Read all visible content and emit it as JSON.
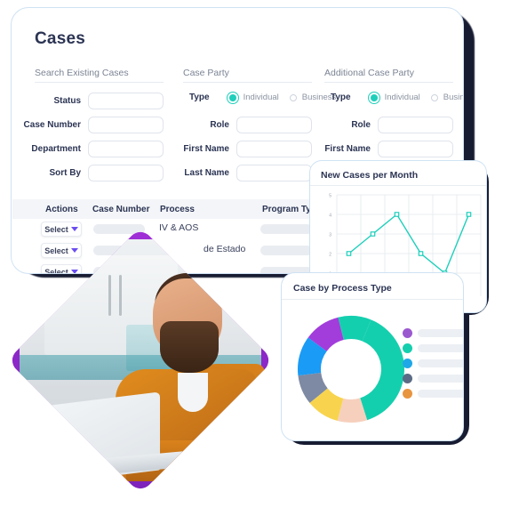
{
  "main_card": {
    "title": "Cases",
    "sections": [
      {
        "heading": "Search Existing Cases"
      },
      {
        "heading": "Case Party"
      },
      {
        "heading": "Additional Case Party"
      }
    ],
    "search_fields": [
      {
        "label": "Status",
        "value": "",
        "placeholder": ""
      },
      {
        "label": "Case Number",
        "value": "",
        "placeholder": ""
      },
      {
        "label": "Department",
        "value": "",
        "placeholder": ""
      },
      {
        "label": "Sort By",
        "value": "",
        "placeholder": ""
      }
    ],
    "case_party": {
      "type_label": "Type",
      "options": [
        {
          "label": "Individual",
          "selected": true
        },
        {
          "label": "Business",
          "selected": false
        }
      ],
      "fields": [
        {
          "label": "Role",
          "value": ""
        },
        {
          "label": "First Name",
          "value": ""
        },
        {
          "label": "Last Name",
          "value": ""
        }
      ]
    },
    "additional_case_party": {
      "type_label": "Type",
      "options": [
        {
          "label": "Individual",
          "selected": true
        },
        {
          "label": "Business",
          "selected": false
        }
      ],
      "fields": [
        {
          "label": "Role",
          "value": ""
        },
        {
          "label": "First Name",
          "value": ""
        },
        {
          "label": "Last Name",
          "value": ""
        }
      ]
    },
    "table": {
      "columns": [
        "Actions",
        "Case Number",
        "Process",
        "Program Type"
      ],
      "rows": [
        {
          "action": "Select",
          "case_number": "",
          "process": "IV & AOS",
          "program_type": ""
        },
        {
          "action": "Select",
          "case_number": "",
          "process": "de Estado",
          "program_type": ""
        },
        {
          "action": "Select",
          "case_number": "",
          "process": "",
          "program_type": ""
        }
      ]
    }
  },
  "line_card": {
    "title": "New Cases per Month"
  },
  "donut_card": {
    "title": "Case by Process Type"
  },
  "colors": {
    "teal": "#1ecfbb",
    "purple": "#8e28c9",
    "chevron": "#6a4df0",
    "navy": "#2b3453",
    "card_border": "#cfe2f3",
    "shadow": "#171c32"
  },
  "chart_data": [
    {
      "type": "line",
      "title": "New Cases per Month",
      "xlabel": "",
      "ylabel": "",
      "x": [
        1,
        2,
        3,
        4,
        5,
        6
      ],
      "values": [
        2,
        3,
        4,
        2,
        1,
        4
      ],
      "ylim": [
        0,
        5
      ],
      "yticks": [
        1,
        2,
        3,
        4,
        5
      ],
      "grid": true,
      "legend": "none",
      "series_color": "#1ecfbb",
      "marker": "open-square"
    },
    {
      "type": "pie",
      "title": "Case by Process Type",
      "donut": true,
      "labels": [
        "",
        "",
        "",
        "",
        "",
        "",
        ""
      ],
      "values": [
        39,
        9,
        10,
        9,
        12,
        11,
        10
      ],
      "slice_colors": [
        "#14cfae",
        "#f6d0bd",
        "#f8d košt",
        "#f8d44e",
        "#7e8aa3",
        "#1a9bf5",
        "#a23ddb"
      ],
      "legend": {
        "position": "right",
        "entries": [
          {
            "label": "",
            "color": "#9b59d0"
          },
          {
            "label": "",
            "color": "#14cfae"
          },
          {
            "label": "",
            "color": "#1fa8e8"
          },
          {
            "label": "",
            "color": "#5c6b85"
          },
          {
            "label": "",
            "color": "#e8953f"
          }
        ]
      }
    }
  ]
}
